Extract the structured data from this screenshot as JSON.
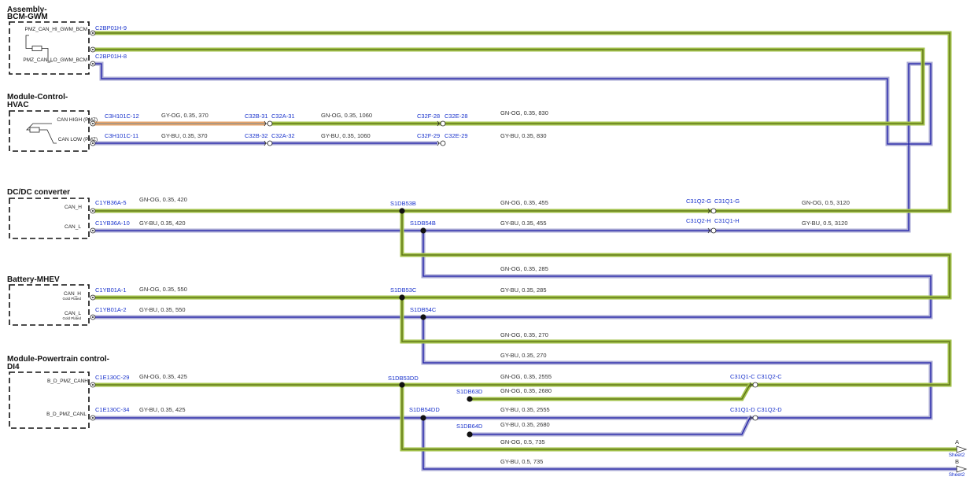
{
  "modules": [
    {
      "id": "bcm",
      "title_lines": [
        "Assembly-",
        "BCM-GWM"
      ],
      "pins": [
        {
          "label": "PMZ_CAN_HI_GWM_BCM",
          "sub": ""
        },
        {
          "label": "PMZ_CAN_LO_GWM_BCM",
          "sub": ""
        }
      ]
    },
    {
      "id": "hvac",
      "title_lines": [
        "Module-Control-",
        "HVAC"
      ],
      "pins": [
        {
          "label": "CAN HIGH (PMZ)",
          "sub": ""
        },
        {
          "label": "CAN LOW (PMZ)",
          "sub": ""
        }
      ]
    },
    {
      "id": "dcdc",
      "title_lines": [
        "DC/DC converter"
      ],
      "pins": [
        {
          "label": "CAN_H",
          "sub": ""
        },
        {
          "label": "CAN_L",
          "sub": ""
        }
      ]
    },
    {
      "id": "battery",
      "title_lines": [
        "Battery-MHEV"
      ],
      "pins": [
        {
          "label": "CAN_H",
          "sub": "Gold Plated"
        },
        {
          "label": "CAN_L",
          "sub": "Gold Plated"
        }
      ]
    },
    {
      "id": "ptcm",
      "title_lines": [
        "Module-Powertrain control-",
        "DI4"
      ],
      "pins": [
        {
          "label": "B_D_PMZ_CANH",
          "sub": ""
        },
        {
          "label": "B_D_PMZ_CANL",
          "sub": ""
        }
      ]
    }
  ],
  "connectors": [
    "C2BP01H-9",
    "C2BP01H-8",
    "C3H101C-12",
    "C3H101C-11",
    "C32B-31",
    "C32A-31",
    "C32B-32",
    "C32A-32",
    "C32F-28",
    "C32E-28",
    "C32F-29",
    "C32E-29",
    "C1YB36A-5",
    "C1YB36A-10",
    "S1DB53B",
    "S1DB54B",
    "C31Q2-G",
    "C31Q1-G",
    "C31Q2-H",
    "C31Q1-H",
    "C1YB01A-1",
    "C1YB01A-2",
    "S1DB53C",
    "S1DB54C",
    "C1E130C-29",
    "C1E130C-34",
    "S1DB53DD",
    "S1DB54DD",
    "S1DB63D",
    "S1DB64D",
    "C31Q1-C",
    "C31Q2-C",
    "C31Q1-D",
    "C31Q2-D"
  ],
  "wire_labels": [
    "GY-OG, 0.35, 370",
    "GY-BU, 0.35, 370",
    "GN-OG, 0.35, 1060",
    "GY-BU, 0.35, 1060",
    "GN-OG, 0.35, 830",
    "GY-BU, 0.35, 830",
    "GN-OG, 0.35, 420",
    "GY-BU, 0.35, 420",
    "GN-OG, 0.35, 455",
    "GY-BU, 0.35, 455",
    "GN-OG, 0.5, 3120",
    "GY-BU, 0.5, 3120",
    "GN-OG, 0.35, 285",
    "GY-BU, 0.35, 285",
    "GN-OG, 0.35, 550",
    "GY-BU, 0.35, 550",
    "GN-OG, 0.35, 270",
    "GY-BU, 0.35, 270",
    "GN-OG, 0.35, 425",
    "GY-BU, 0.35, 425",
    "GN-OG, 0.35, 2555",
    "GN-OG, 0.35, 2680",
    "GY-BU, 0.35, 2555",
    "GY-BU, 0.35, 2680",
    "GN-OG, 0.5, 735",
    "GY-BU, 0.5, 735"
  ],
  "offsheet": [
    {
      "letter": "A",
      "sheet": "Sheet2"
    },
    {
      "letter": "B",
      "sheet": "Sheet2"
    }
  ],
  "wire_colors": {
    "gn_og_outer": "#a2c24a",
    "gn_og_inner": "#5a6e14",
    "gy_og_outer": "#e8a468",
    "gy_og_inner": "#8f8f8f",
    "gy_bu_outer": "#a9a9d4",
    "gy_bu_inner": "#1e1ea8"
  }
}
